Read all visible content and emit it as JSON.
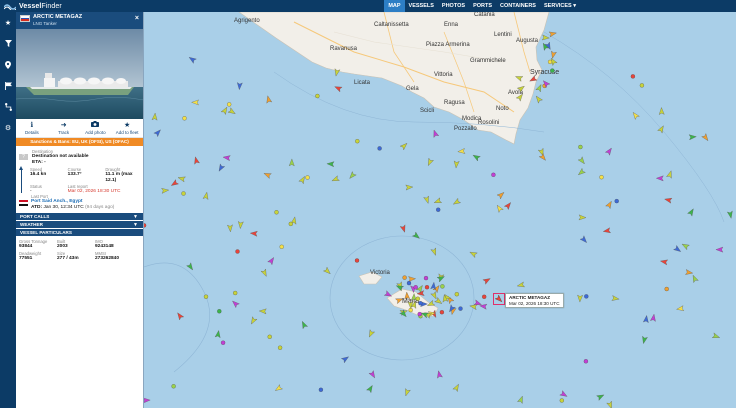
{
  "brand": {
    "name_bold": "Vessel",
    "name_light": "Finder"
  },
  "nav": [
    {
      "label": "MAP",
      "active": true
    },
    {
      "label": "VESSELS",
      "active": false
    },
    {
      "label": "PHOTOS",
      "active": false
    },
    {
      "label": "PORTS",
      "active": false
    },
    {
      "label": "CONTAINERS",
      "active": false
    },
    {
      "label": "SERVICES ▾",
      "active": false
    }
  ],
  "rail_icons": [
    "star-icon",
    "filter-icon",
    "location-pin-icon",
    "flag-icon",
    "route-icon",
    "gear-icon"
  ],
  "vessel": {
    "name": "ARCTIC METAGAZ",
    "type": "LNG Tanker",
    "flag": "russia-flag",
    "actions": [
      {
        "icon": "info-icon",
        "glyph": "ℹ",
        "label": "Details"
      },
      {
        "icon": "track-icon",
        "glyph": "➜",
        "label": "Track"
      },
      {
        "icon": "camera-icon",
        "glyph": "📷",
        "label": "Add photo"
      },
      {
        "icon": "star-icon",
        "glyph": "★",
        "label": "Add to fleet"
      }
    ],
    "sanctions": "Sanctions & Bans: EU, UK (OFSI), US (OFAC)",
    "destination_label": "Destination",
    "destination_value": "Destination not available",
    "eta": "ETA: -",
    "qmark": "?",
    "speed_label": "Speed",
    "speed_value": "16.4 kn",
    "course_label": "Course",
    "course_value": "133.7°",
    "draught_label": "Draught",
    "draught_value": "11.1 m (max 12.1)",
    "status_label": "Status",
    "status_value": "-",
    "last_report_label": "Last report",
    "last_report_value": "Mar 02, 2026 18:30 UTC",
    "last_port_label": "Last Port",
    "last_port_value": "Port Said Anch., Egypt",
    "atd_label": "ATD:",
    "atd_value": "Jan 30, 12:34 UTC",
    "atd_ago": "(94 days ago)"
  },
  "sections": [
    {
      "label": "PORT CALLS",
      "chevron": "▼"
    },
    {
      "label": "WEATHER",
      "chevron": "▼"
    },
    {
      "label": "VESSEL PARTICULARS",
      "chevron": ""
    }
  ],
  "particulars": {
    "gross_label": "Gross Tonnage",
    "gross_value": "93844",
    "built_label": "Built",
    "built_value": "2003",
    "imo_label": "IMO",
    "imo_value": "9243148",
    "dwt_label": "Deadweight",
    "dwt_value": "77551",
    "size_label": "Size",
    "size_value": "277 / 43m",
    "mmsi_label": "MMSI",
    "mmsi_value": "273262840"
  },
  "map": {
    "place_labels": [
      "Agrigento",
      "Caltanissetta",
      "Enna",
      "Catania",
      "Licata",
      "Gela",
      "Ragusa",
      "Modica",
      "Avola",
      "Noto",
      "Syracuse",
      "Ravanusa",
      "Piazza Armerina",
      "Grammichele",
      "Augusta",
      "Lentini",
      "Vittoria",
      "Scicli",
      "Pozzallo",
      "Rosolini",
      "Victoria",
      "Malta"
    ],
    "tooltip_name": "ARCTIC METAGAZ",
    "tooltip_time": "Mar 02, 2026 18:30 UTC"
  },
  "colors": {
    "topbar": "#0c3b66",
    "nav_active": "#2d7ec5",
    "sea": "#a9cfe8",
    "land": "#f2efe9",
    "sanctions": "#f08a24",
    "section": "#1a4c7d",
    "cargo": "#c8d33a",
    "tanker": "#e8443a",
    "passenger": "#3d6ad6",
    "pleasure": "#c23fd4",
    "fishing": "#f0a030",
    "highspeed": "#f4e048"
  }
}
